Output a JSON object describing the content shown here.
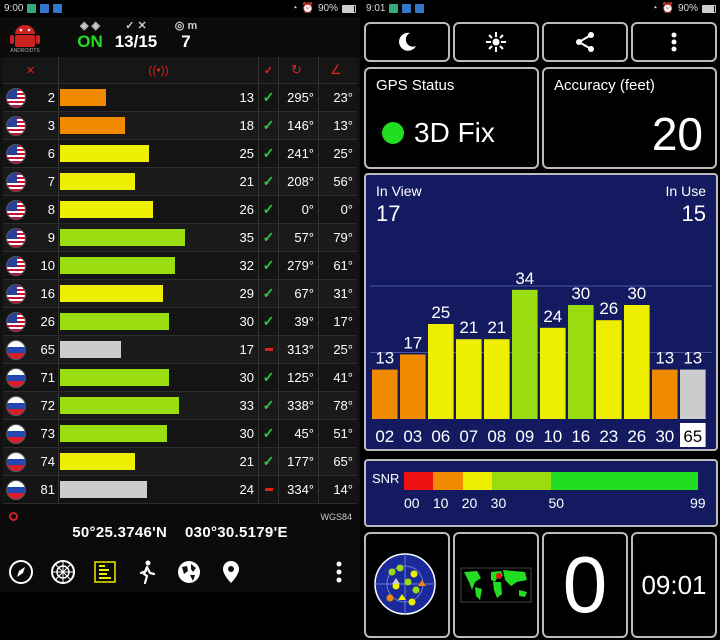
{
  "left_status": {
    "time": "9:00",
    "battery": "90%"
  },
  "right_status": {
    "time": "9:01",
    "battery": "90%"
  },
  "header": {
    "fix_state": "ON",
    "sats_used": "13/15",
    "accuracy": "7",
    "unit": "m"
  },
  "columns": {
    "prn": "prn",
    "snr": "snr",
    "used": "used",
    "azimuth": "az",
    "elevation": "el"
  },
  "satellites": [
    {
      "flag": "us",
      "prn": "2",
      "snr": "13",
      "used": true,
      "azimuth": "295°",
      "elevation": "23°",
      "bar_fill": 0.23,
      "color": "#f08a00"
    },
    {
      "flag": "us",
      "prn": "3",
      "snr": "18",
      "used": true,
      "azimuth": "146°",
      "elevation": "13°",
      "bar_fill": 0.33,
      "color": "#f08a00"
    },
    {
      "flag": "us",
      "prn": "6",
      "snr": "25",
      "used": true,
      "azimuth": "241°",
      "elevation": "25°",
      "bar_fill": 0.45,
      "color": "#eeee00"
    },
    {
      "flag": "us",
      "prn": "7",
      "snr": "21",
      "used": true,
      "azimuth": "208°",
      "elevation": "56°",
      "bar_fill": 0.38,
      "color": "#eeee00"
    },
    {
      "flag": "us",
      "prn": "8",
      "snr": "26",
      "used": true,
      "azimuth": "0°",
      "elevation": "0°",
      "bar_fill": 0.47,
      "color": "#eeee00"
    },
    {
      "flag": "us",
      "prn": "9",
      "snr": "35",
      "used": true,
      "azimuth": "57°",
      "elevation": "79°",
      "bar_fill": 0.63,
      "color": "#99dd11"
    },
    {
      "flag": "us",
      "prn": "10",
      "snr": "32",
      "used": true,
      "azimuth": "279°",
      "elevation": "61°",
      "bar_fill": 0.58,
      "color": "#99dd11"
    },
    {
      "flag": "us",
      "prn": "16",
      "snr": "29",
      "used": true,
      "azimuth": "67°",
      "elevation": "31°",
      "bar_fill": 0.52,
      "color": "#eeee00"
    },
    {
      "flag": "us",
      "prn": "26",
      "snr": "30",
      "used": true,
      "azimuth": "39°",
      "elevation": "17°",
      "bar_fill": 0.55,
      "color": "#99dd11"
    },
    {
      "flag": "ru",
      "prn": "65",
      "snr": "17",
      "used": false,
      "azimuth": "313°",
      "elevation": "25°",
      "bar_fill": 0.31,
      "color": "#cccccc"
    },
    {
      "flag": "ru",
      "prn": "71",
      "snr": "30",
      "used": true,
      "azimuth": "125°",
      "elevation": "41°",
      "bar_fill": 0.55,
      "color": "#99dd11"
    },
    {
      "flag": "ru",
      "prn": "72",
      "snr": "33",
      "used": true,
      "azimuth": "338°",
      "elevation": "78°",
      "bar_fill": 0.6,
      "color": "#99dd11"
    },
    {
      "flag": "ru",
      "prn": "73",
      "snr": "30",
      "used": true,
      "azimuth": "45°",
      "elevation": "51°",
      "bar_fill": 0.54,
      "color": "#99dd11"
    },
    {
      "flag": "ru",
      "prn": "74",
      "snr": "21",
      "used": true,
      "azimuth": "177°",
      "elevation": "65°",
      "bar_fill": 0.38,
      "color": "#eeee00"
    },
    {
      "flag": "ru",
      "prn": "81",
      "snr": "24",
      "used": false,
      "azimuth": "334°",
      "elevation": "14°",
      "bar_fill": 0.44,
      "color": "#cccccc"
    }
  ],
  "position": {
    "lat": "50°25.3746'N",
    "lon": "030°30.5179'E",
    "datum": "WGS84"
  },
  "nav_icons": [
    "compass-icon",
    "radar-icon",
    "bars-icon",
    "walk-icon",
    "globe-icon",
    "location-pin-icon",
    "more-icon"
  ],
  "top_buttons": [
    "moon-icon",
    "sun-icon",
    "share-icon",
    "more-icon"
  ],
  "gps_status": {
    "title": "GPS Status",
    "value": "3D Fix",
    "color": "#22dd22"
  },
  "accuracy": {
    "title": "Accuracy (feet)",
    "value": "20"
  },
  "sky": {
    "in_view_label": "In View",
    "in_view": "17",
    "in_use_label": "In Use",
    "in_use": "15"
  },
  "chart_data": {
    "type": "bar",
    "categories": [
      "02",
      "03",
      "06",
      "07",
      "08",
      "09",
      "10",
      "16",
      "23",
      "26",
      "30",
      "65"
    ],
    "values": [
      13,
      17,
      25,
      21,
      21,
      34,
      24,
      30,
      26,
      30,
      13,
      13
    ],
    "colors": [
      "#f08a00",
      "#f08a00",
      "#eeee00",
      "#eeee00",
      "#eeee00",
      "#99dd11",
      "#eeee00",
      "#99dd11",
      "#eeee00",
      "#eeee00",
      "#f08a00",
      "#cccccc"
    ],
    "highlight": "65",
    "ylim": [
      0,
      50
    ]
  },
  "snr_legend": {
    "title": "SNR",
    "ticks": [
      "00",
      "10",
      "20",
      "30",
      "50",
      "99"
    ]
  },
  "bottom_tiles": {
    "count": "0",
    "time": "09:01"
  }
}
